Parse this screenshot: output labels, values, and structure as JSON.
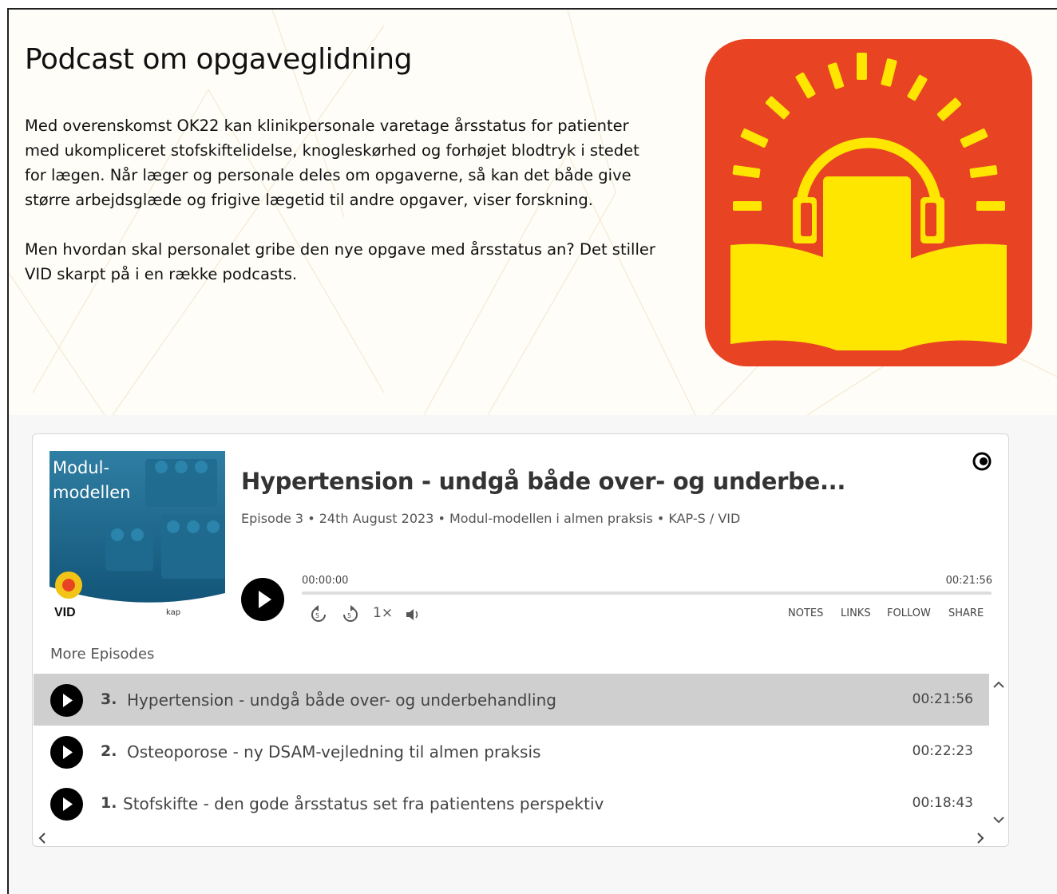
{
  "page": {
    "title": "Podcast om opgaveglidning",
    "paragraphs": [
      "Med overenskomst OK22 kan klinikpersonale varetage årsstatus for patienter med ukompliceret stofskiftelidelse, knogleskørhed og forhøjet blodtryk i stedet for lægen. Når læger og personale deles om opgaverne, så kan det både give større arbejdsglæde og frigive lægetid til andre opgaver, viser forskning.",
      "Men hvordan skal personalet gribe den nye opgave med årsstatus an? Det stiller VID skarpt på i en række podcasts."
    ],
    "colors": {
      "logo_bg": "#e84424",
      "logo_fg": "#ffe600",
      "accent_dark": "#000000"
    }
  },
  "player": {
    "cover": {
      "title_line1": "Modul-",
      "title_line2": "modellen",
      "brand_left": "VID",
      "brand_right": "kap"
    },
    "episode_title": "Hypertension - undgå både over- og underbe...",
    "meta": "Episode 3 • 24th August 2023 • Modul-modellen i almen praksis • KAP-S / VID",
    "current_time": "00:00:00",
    "total_time": "00:21:56",
    "progress": 0,
    "speed": "1×",
    "menu": [
      "NOTES",
      "LINKS",
      "FOLLOW",
      "SHARE"
    ],
    "more_label": "More Episodes",
    "episodes": [
      {
        "num": "3.",
        "title": "Hypertension - undgå både over- og underbehandling",
        "duration": "00:21:56",
        "active": true
      },
      {
        "num": "2.",
        "title": "Osteoporose - ny DSAM-vejledning til almen praksis",
        "duration": "00:22:23",
        "active": false
      },
      {
        "num": "1.",
        "title": "Stofskifte - den gode årsstatus set fra patientens perspektiv",
        "duration": "00:18:43",
        "active": false
      }
    ],
    "icons": [
      "play-icon",
      "rewind-icon",
      "forward-icon",
      "volume-icon",
      "captivate-logo-icon",
      "chevron-up-icon",
      "chevron-down-icon",
      "chevron-left-icon",
      "chevron-right-icon"
    ]
  }
}
